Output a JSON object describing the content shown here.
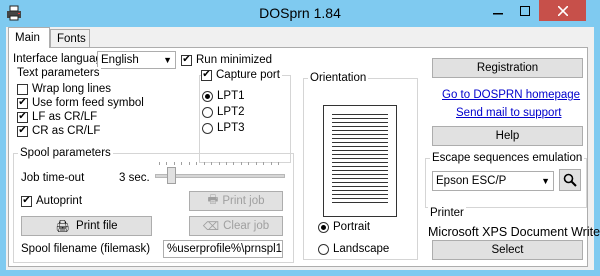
{
  "window": {
    "title": "DOSprn 1.84"
  },
  "tabs": [
    {
      "label": "Main"
    },
    {
      "label": "Fonts"
    }
  ],
  "left": {
    "interface_language_label": "Interface language",
    "interface_language_value": "English",
    "run_minimized": {
      "label": "Run minimized",
      "checked": true
    },
    "text_params": {
      "title": "Text parameters",
      "wrap": {
        "label": "Wrap long lines",
        "checked": false
      },
      "formfeed": {
        "label": "Use form feed symbol",
        "checked": true
      },
      "lf": {
        "label": "LF as CR/LF",
        "checked": true
      },
      "cr": {
        "label": "CR as CR/LF",
        "checked": true
      }
    },
    "capture": {
      "label": "Capture port",
      "checked": true,
      "ports": [
        "LPT1",
        "LPT2",
        "LPT3"
      ],
      "selected": "LPT1"
    },
    "spool": {
      "title": "Spool parameters",
      "job_timeout_label": "Job time-out",
      "job_timeout_value": "3 sec.",
      "job_timeout_fraction": 0.1,
      "autoprint": {
        "label": "Autoprint",
        "checked": true
      },
      "print_job": "Print job",
      "print_file": "Print file",
      "clear_job": "Clear job",
      "filename_label": "Spool filename (filemask)",
      "filename_value": "%userprofile%\\prnspl1"
    }
  },
  "orientation": {
    "title": "Orientation",
    "portrait": "Portrait",
    "landscape": "Landscape",
    "selected": "Portrait"
  },
  "right": {
    "registration": "Registration",
    "homepage_link": "Go to DOSPRN homepage",
    "mail_link": "Send mail to support",
    "help": "Help",
    "escape_title": "Escape sequences emulation",
    "escape_value": "Epson ESC/P",
    "printer_title": "Printer",
    "printer_name": "Microsoft XPS Document Write",
    "select": "Select"
  },
  "colors": {
    "titlebar": "#7fcaf0",
    "close_button": "#c7504a",
    "link": "#0000cc"
  }
}
